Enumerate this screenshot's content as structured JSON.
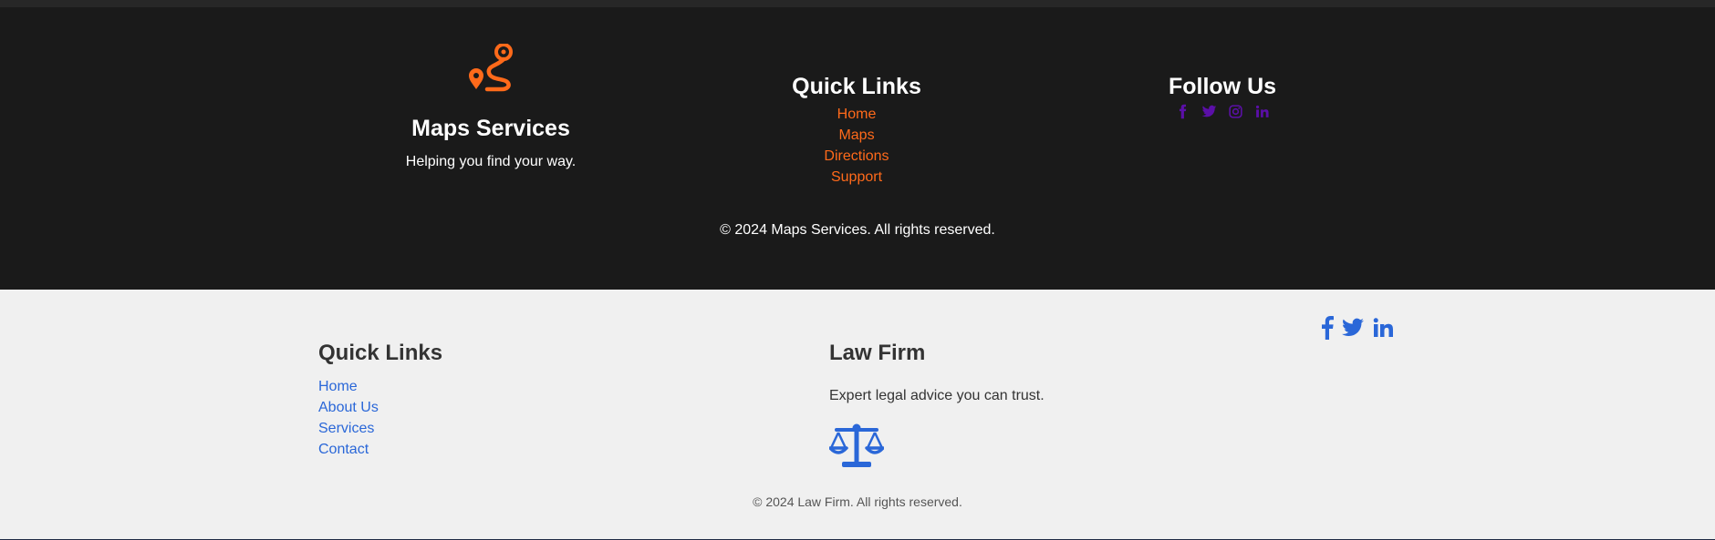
{
  "maps_footer": {
    "brand": {
      "title": "Maps Services",
      "tagline": "Helping you find your way.",
      "logo_icon": "route-pin-icon"
    },
    "quick_links": {
      "title": "Quick Links",
      "items": [
        "Home",
        "Maps",
        "Directions",
        "Support"
      ]
    },
    "follow": {
      "title": "Follow Us",
      "icons": [
        "facebook-icon",
        "twitter-icon",
        "instagram-icon",
        "linkedin-icon"
      ]
    },
    "copyright": "© 2024 Maps Services. All rights reserved."
  },
  "law_footer": {
    "quick_links": {
      "title": "Quick Links",
      "items": [
        "Home",
        "About Us",
        "Services",
        "Contact"
      ]
    },
    "firm": {
      "title": "Law Firm",
      "description": "Expert legal advice you can trust.",
      "icon": "scales-of-justice-icon"
    },
    "social_icons": [
      "facebook-icon",
      "twitter-icon",
      "linkedin-icon"
    ],
    "copyright": "© 2024 Law Firm. All rights reserved."
  },
  "colors": {
    "dark_bg": "#1a1a1a",
    "orange_accent": "#ff6a1a",
    "purple_social": "#5b0fa8",
    "blue_accent": "#2a67d8",
    "light_bg": "#f0f0f0"
  }
}
